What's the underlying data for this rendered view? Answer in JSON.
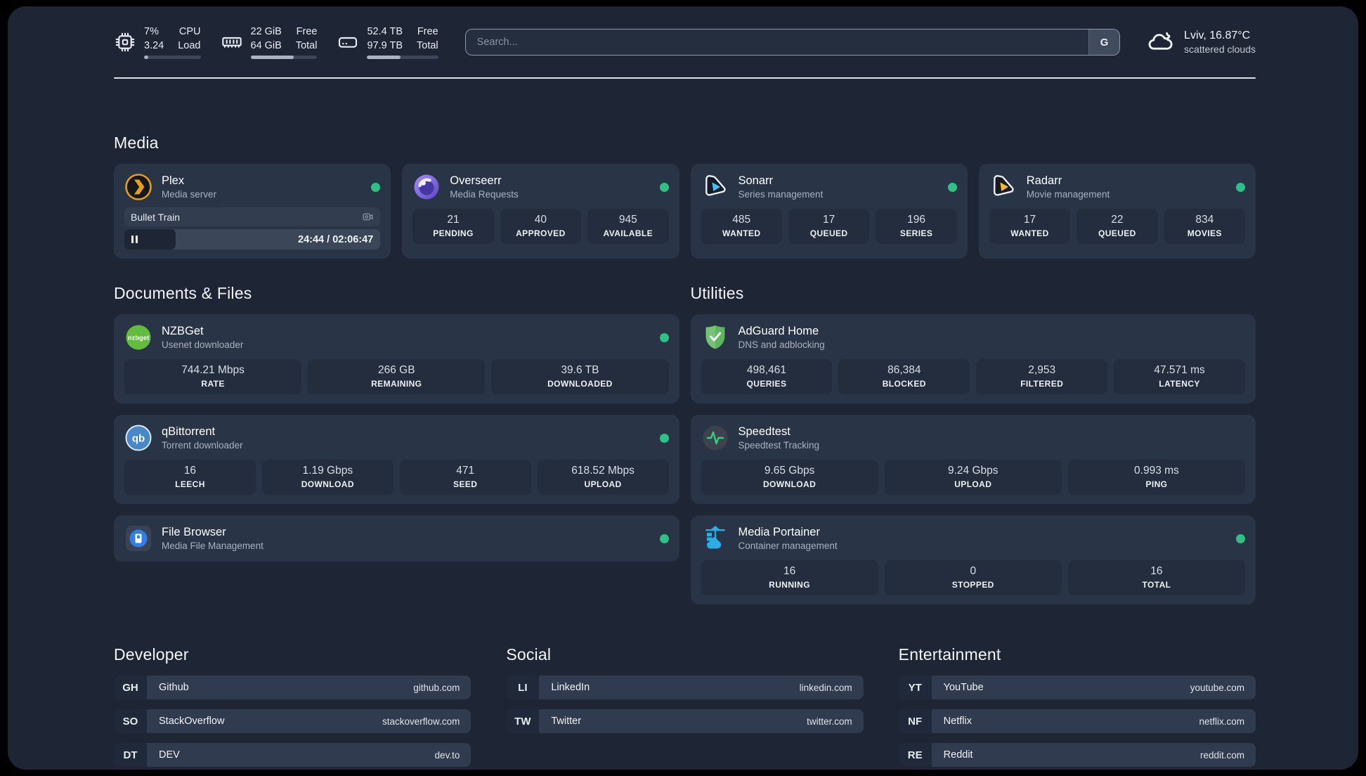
{
  "topbar": {
    "stats": [
      {
        "id": "cpu",
        "icon": "cpu-icon",
        "values": [
          "7%",
          "3.24"
        ],
        "labels": [
          "CPU",
          "Load"
        ],
        "progress_percent": 7
      },
      {
        "id": "memory",
        "icon": "ram-icon",
        "values": [
          "22 GiB",
          "64 GiB"
        ],
        "labels": [
          "Free",
          "Total"
        ],
        "progress_percent": 65
      },
      {
        "id": "disk",
        "icon": "disk-icon",
        "values": [
          "52.4 TB",
          "97.9 TB"
        ],
        "labels": [
          "Free",
          "Total"
        ],
        "progress_percent": 47
      }
    ],
    "search": {
      "placeholder": "Search...",
      "button_label": "G"
    },
    "weather": {
      "icon": "cloud-icon",
      "location_temp": "Lviv, 16.87°C",
      "condition": "scattered clouds"
    }
  },
  "sections": {
    "media": {
      "title": "Media",
      "cards": [
        {
          "id": "plex",
          "icon": "plex-icon",
          "name": "Plex",
          "description": "Media server",
          "status_dot": true,
          "player": {
            "track": "Bullet Train",
            "time": "24:44 / 02:06:47",
            "progress_percent": 20
          }
        },
        {
          "id": "overseerr",
          "icon": "overseerr-icon",
          "name": "Overseerr",
          "description": "Media Requests",
          "status_dot": true,
          "stats": [
            {
              "value": "21",
              "label": "PENDING"
            },
            {
              "value": "40",
              "label": "APPROVED"
            },
            {
              "value": "945",
              "label": "AVAILABLE"
            }
          ]
        },
        {
          "id": "sonarr",
          "icon": "sonarr-icon",
          "name": "Sonarr",
          "description": "Series management",
          "status_dot": true,
          "stats": [
            {
              "value": "485",
              "label": "WANTED"
            },
            {
              "value": "17",
              "label": "QUEUED"
            },
            {
              "value": "196",
              "label": "SERIES"
            }
          ]
        },
        {
          "id": "radarr",
          "icon": "radarr-icon",
          "name": "Radarr",
          "description": "Movie management",
          "status_dot": true,
          "stats": [
            {
              "value": "17",
              "label": "WANTED"
            },
            {
              "value": "22",
              "label": "QUEUED"
            },
            {
              "value": "834",
              "label": "MOVIES"
            }
          ]
        }
      ]
    },
    "documents": {
      "title": "Documents & Files",
      "cards": [
        {
          "id": "nzbget",
          "icon": "nzbget-icon",
          "name": "NZBGet",
          "description": "Usenet downloader",
          "status_dot": true,
          "stats": [
            {
              "value": "744.21 Mbps",
              "label": "RATE"
            },
            {
              "value": "266 GB",
              "label": "REMAINING"
            },
            {
              "value": "39.6 TB",
              "label": "DOWNLOADED"
            }
          ]
        },
        {
          "id": "qbittorrent",
          "icon": "qbittorrent-icon",
          "name": "qBittorrent",
          "description": "Torrent downloader",
          "status_dot": true,
          "stats": [
            {
              "value": "16",
              "label": "LEECH"
            },
            {
              "value": "1.19 Gbps",
              "label": "DOWNLOAD"
            },
            {
              "value": "471",
              "label": "SEED"
            },
            {
              "value": "618.52 Mbps",
              "label": "UPLOAD"
            }
          ]
        },
        {
          "id": "filebrowser",
          "icon": "filebrowser-icon",
          "name": "File Browser",
          "description": "Media File Management",
          "status_dot": true
        }
      ]
    },
    "utilities": {
      "title": "Utilities",
      "cards": [
        {
          "id": "adguard",
          "icon": "adguard-icon",
          "name": "AdGuard Home",
          "description": "DNS and adblocking",
          "status_dot": false,
          "stats": [
            {
              "value": "498,461",
              "label": "QUERIES"
            },
            {
              "value": "86,384",
              "label": "BLOCKED"
            },
            {
              "value": "2,953",
              "label": "FILTERED"
            },
            {
              "value": "47.571 ms",
              "label": "LATENCY"
            }
          ]
        },
        {
          "id": "speedtest",
          "icon": "speedtest-icon",
          "name": "Speedtest",
          "description": "Speedtest Tracking",
          "status_dot": false,
          "stats": [
            {
              "value": "9.65 Gbps",
              "label": "DOWNLOAD"
            },
            {
              "value": "9.24 Gbps",
              "label": "UPLOAD"
            },
            {
              "value": "0.993 ms",
              "label": "PING"
            }
          ]
        },
        {
          "id": "portainer",
          "icon": "portainer-icon",
          "name": "Media Portainer",
          "description": "Container management",
          "status_dot": true,
          "stats": [
            {
              "value": "16",
              "label": "RUNNING"
            },
            {
              "value": "0",
              "label": "STOPPED"
            },
            {
              "value": "16",
              "label": "TOTAL"
            }
          ]
        }
      ]
    }
  },
  "bookmarks": [
    {
      "title": "Developer",
      "links": [
        {
          "badge": "GH",
          "name": "Github",
          "url": "github.com"
        },
        {
          "badge": "SO",
          "name": "StackOverflow",
          "url": "stackoverflow.com"
        },
        {
          "badge": "DT",
          "name": "DEV",
          "url": "dev.to"
        }
      ]
    },
    {
      "title": "Social",
      "links": [
        {
          "badge": "LI",
          "name": "LinkedIn",
          "url": "linkedin.com"
        },
        {
          "badge": "TW",
          "name": "Twitter",
          "url": "twitter.com"
        }
      ]
    },
    {
      "title": "Entertainment",
      "links": [
        {
          "badge": "YT",
          "name": "YouTube",
          "url": "youtube.com"
        },
        {
          "badge": "NF",
          "name": "Netflix",
          "url": "netflix.com"
        },
        {
          "badge": "RE",
          "name": "Reddit",
          "url": "reddit.com"
        }
      ]
    }
  ],
  "colors": {
    "status_online": "#2bc284",
    "plex": "#e5a00d",
    "overseerr": "#7a66e0",
    "sonarr": "#38c6f4",
    "radarr": "#ffb917",
    "nzbget": "#63bd3c",
    "qbittorrent": "#4888c8",
    "adguard": "#5fb65c",
    "speedtest_pulse": "#35d07f",
    "portainer": "#29aee6",
    "filebrowser": "#2f7fe8"
  }
}
